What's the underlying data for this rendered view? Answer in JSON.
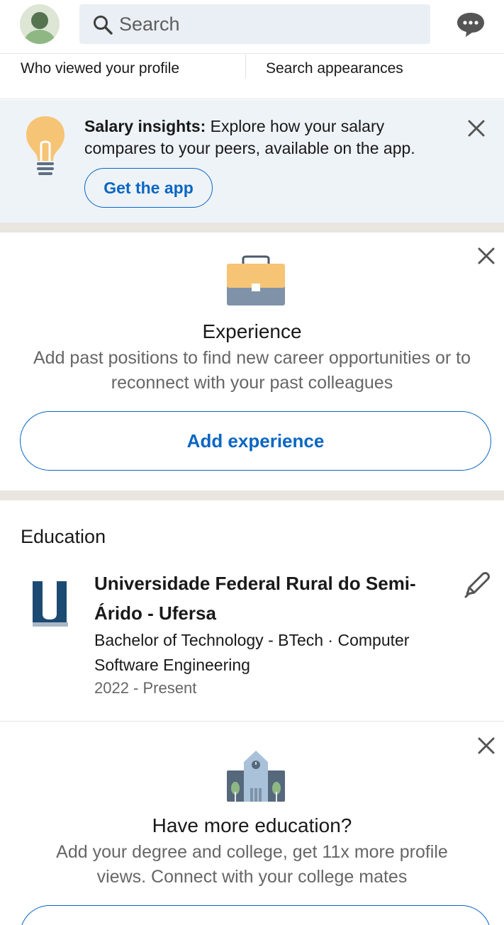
{
  "header": {
    "search_placeholder": "Search",
    "icons": [
      "avatar",
      "search-icon",
      "messaging-icon"
    ]
  },
  "stats": {
    "who_viewed": "Who viewed your profile",
    "search_appearances": "Search appearances"
  },
  "salary_card": {
    "bold": "Salary insights:",
    "text": " Explore how your salary compares to your peers, available on the app.",
    "button": "Get the app"
  },
  "experience_card": {
    "title": "Experience",
    "description": "Add past positions to find new career opportunities or to reconnect with your past colleagues",
    "button": "Add experience"
  },
  "education": {
    "heading": "Education",
    "school": "Universidade Federal Rural do Semi-Árido - Ufersa",
    "degree": "Bachelor of Technology - BTech · Computer Software Engineering",
    "dates": "2022 - Present"
  },
  "more_education_card": {
    "title": "Have more education?",
    "description": "Add your degree and college, get 11x more profile views. Connect with your college mates"
  },
  "colors": {
    "accent": "#0a66c2",
    "card_tint": "#eef3f8",
    "section_gap": "#e9e5df",
    "muted_text": "#666666"
  }
}
